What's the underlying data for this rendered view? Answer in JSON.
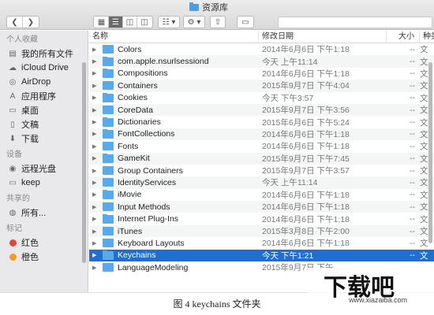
{
  "window": {
    "title": "资源库"
  },
  "toolbar": {
    "view_icon_names": [
      "icon-view-icon",
      "list-view-icon",
      "column-view-icon",
      "coverflow-view-icon"
    ],
    "group_label": "☷ ▾",
    "action_label": "⚙ ▾"
  },
  "sidebar": {
    "sections": [
      {
        "heading": "个人收藏",
        "items": [
          {
            "label": "我的所有文件",
            "icon": "all-files-icon",
            "glyph": "▤"
          },
          {
            "label": "iCloud Drive",
            "icon": "cloud-icon",
            "glyph": "☁"
          },
          {
            "label": "AirDrop",
            "icon": "airdrop-icon",
            "glyph": "◎"
          },
          {
            "label": "应用程序",
            "icon": "applications-icon",
            "glyph": "A"
          },
          {
            "label": "桌面",
            "icon": "desktop-icon",
            "glyph": "▭"
          },
          {
            "label": "文稿",
            "icon": "documents-icon",
            "glyph": "▯"
          },
          {
            "label": "下载",
            "icon": "downloads-icon",
            "glyph": "⬇"
          }
        ]
      },
      {
        "heading": "设备",
        "items": [
          {
            "label": "远程光盘",
            "icon": "remote-disc-icon",
            "glyph": "◉"
          },
          {
            "label": "keep",
            "icon": "drive-icon",
            "glyph": "▭"
          }
        ]
      },
      {
        "heading": "共享的",
        "items": [
          {
            "label": "所有...",
            "icon": "network-icon",
            "glyph": "◍"
          }
        ]
      },
      {
        "heading": "标记",
        "items": [
          {
            "label": "红色",
            "icon": "tag-red-icon",
            "color": "#e0463b"
          },
          {
            "label": "橙色",
            "icon": "tag-orange-icon",
            "color": "#f39a2c"
          }
        ]
      }
    ]
  },
  "list": {
    "headers": {
      "name": "名称",
      "date": "修改日期",
      "size": "大小",
      "kind": "种类"
    },
    "rows": [
      {
        "name": "Colors",
        "date": "2014年6月6日 下午1:18",
        "size": "--",
        "kind": "文"
      },
      {
        "name": "com.apple.nsurlsessiond",
        "date": "今天 上午11:14",
        "size": "--",
        "kind": "文"
      },
      {
        "name": "Compositions",
        "date": "2014年6月6日 下午1:18",
        "size": "--",
        "kind": "文"
      },
      {
        "name": "Containers",
        "date": "2015年9月7日 下午4:04",
        "size": "--",
        "kind": "文"
      },
      {
        "name": "Cookies",
        "date": "今天 下午3:57",
        "size": "--",
        "kind": "文"
      },
      {
        "name": "CoreData",
        "date": "2015年9月7日 下午3:56",
        "size": "--",
        "kind": "文"
      },
      {
        "name": "Dictionaries",
        "date": "2015年6月6日 下午5:24",
        "size": "--",
        "kind": "文"
      },
      {
        "name": "FontCollections",
        "date": "2014年6月6日 下午1:18",
        "size": "--",
        "kind": "文"
      },
      {
        "name": "Fonts",
        "date": "2014年6月6日 下午1:18",
        "size": "--",
        "kind": "文"
      },
      {
        "name": "GameKit",
        "date": "2015年9月7日 下午7:45",
        "size": "--",
        "kind": "文"
      },
      {
        "name": "Group Containers",
        "date": "2015年9月7日 下午3:57",
        "size": "--",
        "kind": "文"
      },
      {
        "name": "IdentityServices",
        "date": "今天 上午11:14",
        "size": "--",
        "kind": "文"
      },
      {
        "name": "iMovie",
        "date": "2014年6月6日 下午1:18",
        "size": "--",
        "kind": "文"
      },
      {
        "name": "Input Methods",
        "date": "2014年6月6日 下午1:18",
        "size": "--",
        "kind": "文"
      },
      {
        "name": "Internet Plug-Ins",
        "date": "2014年6月6日 下午1:18",
        "size": "--",
        "kind": "文"
      },
      {
        "name": "iTunes",
        "date": "2015年3月8日 下午2:00",
        "size": "--",
        "kind": "文"
      },
      {
        "name": "Keyboard Layouts",
        "date": "2014年6月6日 下午1:18",
        "size": "--",
        "kind": "文"
      },
      {
        "name": "Keychains",
        "date": "今天 下午1:21",
        "size": "--",
        "kind": "文",
        "selected": true
      },
      {
        "name": "LanguageModeling",
        "date": "2015年9月7日 下午...",
        "size": "",
        "kind": ""
      }
    ]
  },
  "caption": "图 4  keychains 文件夹",
  "watermark": {
    "text": "下载吧",
    "url": "www.xiazaiba.com"
  },
  "colors": {
    "selection": "#1f6ed4",
    "folder": "#5aa9ea",
    "sidebar_bg": "#e9e9eb"
  }
}
